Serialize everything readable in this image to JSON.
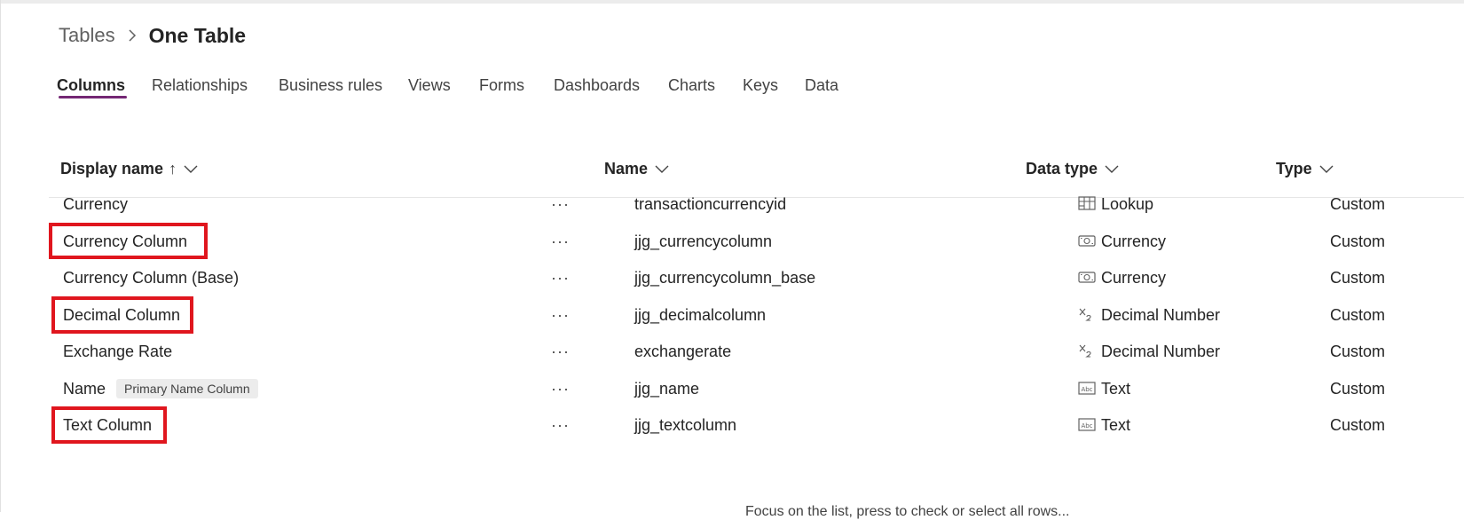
{
  "breadcrumb": {
    "parent": "Tables",
    "current": "One Table"
  },
  "tabs": [
    {
      "label": "Columns",
      "active": true
    },
    {
      "label": "Relationships"
    },
    {
      "label": "Business rules"
    },
    {
      "label": "Views"
    },
    {
      "label": "Forms"
    },
    {
      "label": "Dashboards"
    },
    {
      "label": "Charts"
    },
    {
      "label": "Keys"
    },
    {
      "label": "Data"
    }
  ],
  "table": {
    "headers": {
      "display_name": "Display name",
      "sort_indicator": "↑",
      "name": "Name",
      "data_type": "Data type",
      "type": "Type"
    },
    "more_label": "···",
    "rows": [
      {
        "display_name": "Currency",
        "name": "transactioncurrencyid",
        "data_type": "Lookup",
        "data_type_icon": "lookup-icon",
        "type": "Custom"
      },
      {
        "display_name": "Currency Column",
        "name": "jjg_currencycolumn",
        "data_type": "Currency",
        "data_type_icon": "currency-icon",
        "type": "Custom",
        "highlighted": true
      },
      {
        "display_name": "Currency Column (Base)",
        "name": "jjg_currencycolumn_base",
        "data_type": "Currency",
        "data_type_icon": "currency-icon",
        "type": "Custom"
      },
      {
        "display_name": "Decimal Column",
        "name": "jjg_decimalcolumn",
        "data_type": "Decimal Number",
        "data_type_icon": "decimal-number-icon",
        "type": "Custom",
        "highlighted": true
      },
      {
        "display_name": "Exchange Rate",
        "name": "exchangerate",
        "data_type": "Decimal Number",
        "data_type_icon": "decimal-number-icon",
        "type": "Custom"
      },
      {
        "display_name": "Name",
        "badge": "Primary Name Column",
        "name": "jjg_name",
        "data_type": "Text",
        "data_type_icon": "text-icon",
        "type": "Custom"
      },
      {
        "display_name": "Text Column",
        "name": "jjg_textcolumn",
        "data_type": "Text",
        "data_type_icon": "text-icon",
        "type": "Custom",
        "highlighted": true
      }
    ]
  },
  "footer": {
    "text": "Focus on the list, press to check or select all rows..."
  },
  "colors": {
    "accent": "#742774",
    "highlight": "#e0161e",
    "badge_bg": "#ececec"
  }
}
